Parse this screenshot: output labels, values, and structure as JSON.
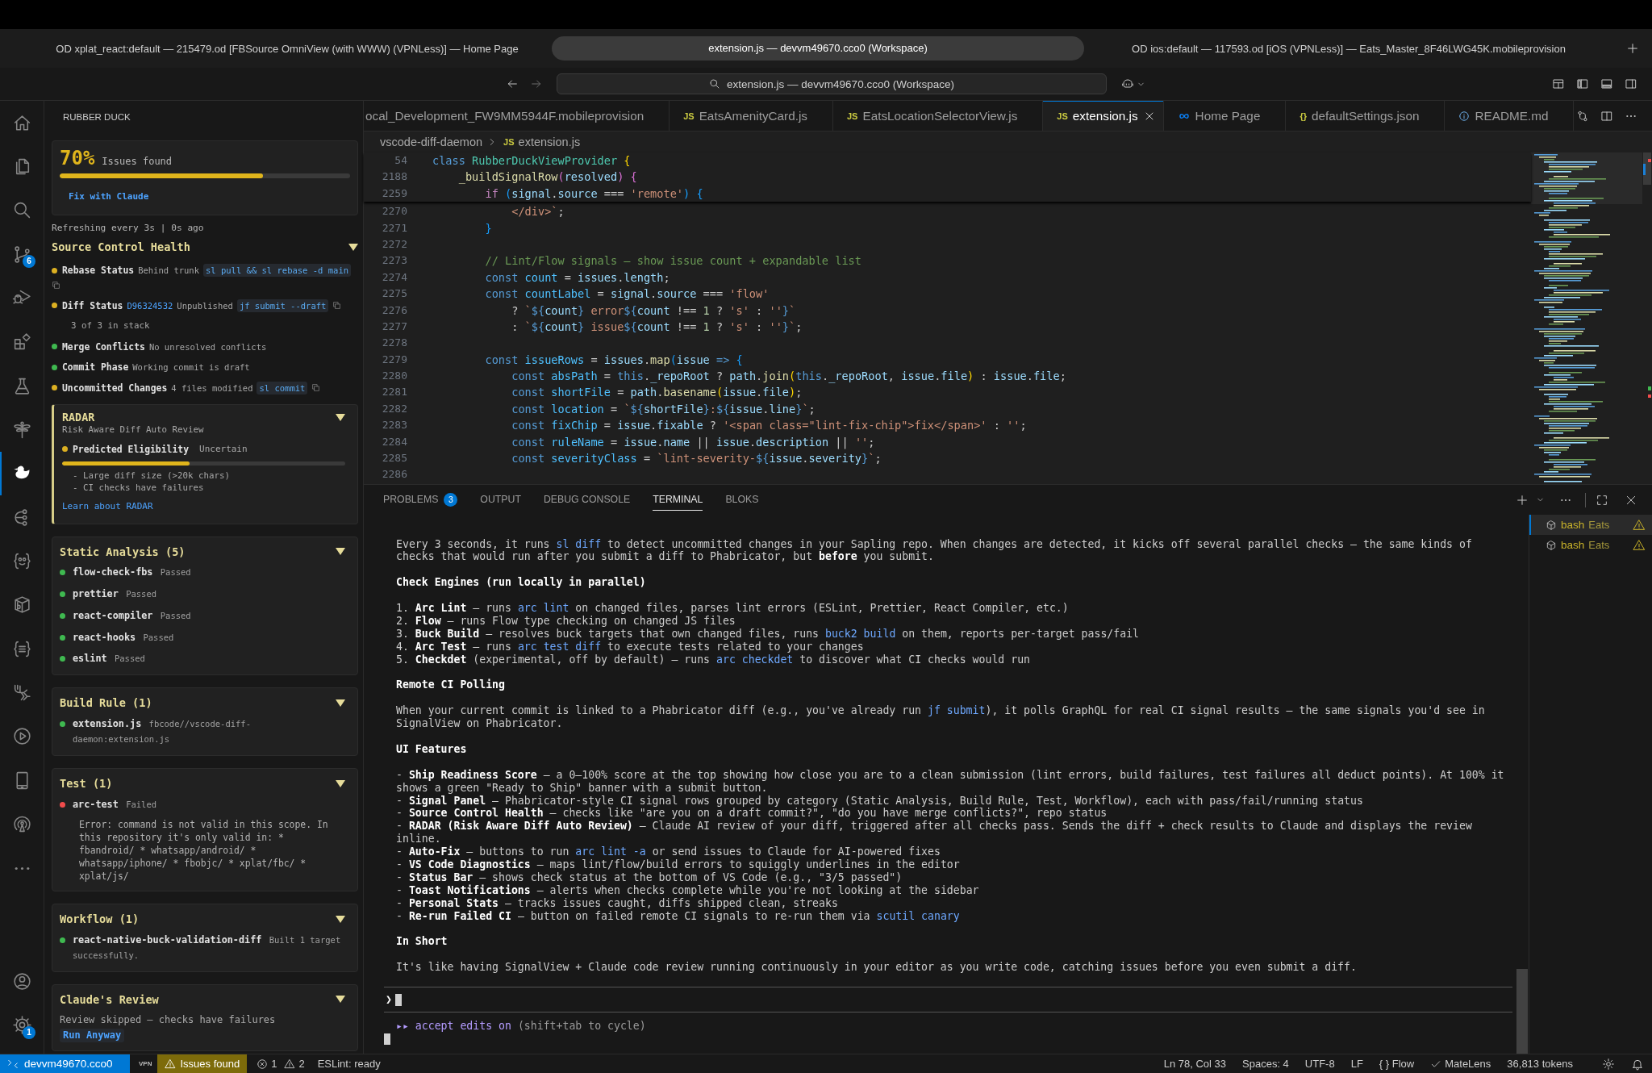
{
  "browser_tabs": [
    {
      "title": "OD xplat_react:default — 215479.od [FBSource OmniView (with WWW) (VPNLess)] — Home Page",
      "selected": false
    },
    {
      "title": "extension.js — devvm49670.cco0 (Workspace)",
      "selected": true
    },
    {
      "title": "OD ios:default — 117593.od [iOS (VPNLess)] — Eats_Master_8F46LWG45K.mobileprovision",
      "selected": false
    }
  ],
  "command_center": {
    "text": "extension.js — devvm49670.cco0 (Workspace)"
  },
  "activity_bar": {
    "items": [
      {
        "selected": false
      },
      {
        "selected": false
      },
      {
        "selected": false
      },
      {
        "selected": false,
        "badge": "6"
      },
      {
        "selected": false
      },
      {
        "selected": false
      },
      {
        "selected": false
      },
      {
        "selected": false
      },
      {
        "selected": true
      },
      {
        "selected": false
      },
      {
        "selected": false
      },
      {
        "selected": false
      },
      {
        "selected": false
      },
      {
        "selected": false
      },
      {
        "selected": false
      },
      {
        "selected": false
      },
      {
        "selected": false
      },
      {
        "selected": false
      }
    ],
    "settings_badge": "1"
  },
  "sidebar": {
    "title": "RUBBER DUCK",
    "score": {
      "value": "70%",
      "label": "Issues found",
      "level": 0.7,
      "action": "Fix with Claude"
    },
    "refresh": "Refreshing every 3s | 0s ago",
    "source_control": {
      "title": "Source Control Health",
      "expanded": true,
      "rows": [
        {
          "color": "#dcb022",
          "label": "Rebase Status",
          "detail": "Behind trunk",
          "command": "sl pull && sl rebase -d main"
        },
        {
          "color": "#dcb022",
          "label": "Diff Status",
          "link": "D96324532",
          "detail": "Unpublished",
          "command": "jf submit --draft",
          "note": "3 of 3 in stack"
        },
        {
          "color": "#3fb950",
          "label": "Merge Conflicts",
          "detail": "No unresolved conflicts"
        },
        {
          "color": "#3fb950",
          "label": "Commit Phase",
          "detail": "Working commit is draft"
        },
        {
          "color": "#dcb022",
          "label": "Uncommitted Changes",
          "detail": "4 files modified",
          "command": "sl commit"
        }
      ]
    },
    "radar": {
      "title": "RADAR",
      "subtitle": "Risk Aware Diff Auto Review",
      "expanded": true,
      "color": "#dcb022",
      "label": "Predicted Eligibility",
      "value": "Uncertain",
      "level": 0.45,
      "reasons": [
        "- Large diff size (>20k chars)",
        "- CI checks have failures"
      ],
      "link": "Learn about RADAR"
    },
    "groups": [
      {
        "title": "Static Analysis (5)",
        "expanded": true,
        "signals": [
          {
            "color": "#3fb950",
            "name": "flow-check-fbs",
            "result": "Passed"
          },
          {
            "color": "#3fb950",
            "name": "prettier",
            "result": "Passed"
          },
          {
            "color": "#3fb950",
            "name": "react-compiler",
            "result": "Passed"
          },
          {
            "color": "#3fb950",
            "name": "react-hooks",
            "result": "Passed"
          },
          {
            "color": "#3fb950",
            "name": "eslint",
            "result": "Passed"
          }
        ]
      },
      {
        "title": "Build Rule (1)",
        "expanded": true,
        "signals": [
          {
            "color": "#3fb950",
            "name": "extension.js",
            "result": "fbcode//vscode-diff-daemon:extension.js"
          }
        ]
      },
      {
        "title": "Test (1)",
        "expanded": true,
        "signals": [
          {
            "color": "#f14c4c",
            "name": "arc-test",
            "result": "Failed",
            "error": "Error: command is not valid in this scope. In this repository it's only valid in: * fbandroid/ * whatsapp/android/ * whatsapp/iphone/ * fbobjc/ * xplat/fbc/ * xplat/js/"
          }
        ]
      },
      {
        "title": "Workflow (1)",
        "expanded": true,
        "signals": [
          {
            "color": "#3fb950",
            "name": "react-native-buck-validation-diff",
            "result": "Built 1 target successfully."
          }
        ]
      }
    ],
    "review": {
      "title": "Claude's Review",
      "expanded": true,
      "message": "Review skipped — checks have failures",
      "action": "Run Anyway"
    }
  },
  "editor_tabs": [
    {
      "label": "ocal_Development_FW9MM5944F.mobileprovision",
      "kind": "plain",
      "selected": false
    },
    {
      "label": "EatsAmenityCard.js",
      "kind": "badge",
      "badge": "JS",
      "selected": false
    },
    {
      "label": "EatsLocationSelectorView.js",
      "kind": "badge",
      "badge": "JS",
      "selected": false
    },
    {
      "label": "extension.js",
      "kind": "badge",
      "badge": "JS",
      "selected": true
    },
    {
      "label": "Home Page",
      "kind": "page",
      "selected": false
    },
    {
      "label": "defaultSettings.json",
      "kind": "badge",
      "badge": "{}",
      "selected": false
    },
    {
      "label": "README.md",
      "kind": "info",
      "selected": false
    }
  ],
  "breadcrumb": {
    "folder": "vscode-diff-daemon",
    "file_badge": "JS",
    "file": "extension.js"
  },
  "editor": {
    "sticky_lines": [
      {
        "number": "54",
        "tokens": [
          {
            "kind": "keyword",
            "text": "class "
          },
          {
            "kind": "type",
            "text": "RubberDuckViewProvider "
          },
          {
            "kind": "bracket1",
            "text": "{"
          }
        ]
      },
      {
        "number": "2188",
        "tokens": [
          {
            "kind": "function",
            "text": "    _buildSignalRow"
          },
          {
            "kind": "bracket2",
            "text": "("
          },
          {
            "kind": "variable",
            "text": "resolved"
          },
          {
            "kind": "bracket2",
            "text": ") {"
          }
        ]
      },
      {
        "number": "2259",
        "tokens": [
          {
            "kind": "control",
            "text": "        if "
          },
          {
            "kind": "bracket3",
            "text": "("
          },
          {
            "kind": "variable",
            "text": "signal"
          },
          {
            "kind": "plain",
            "text": "."
          },
          {
            "kind": "variable",
            "text": "source"
          },
          {
            "kind": "plain",
            "text": " === "
          },
          {
            "kind": "string",
            "text": "'remote'"
          },
          {
            "kind": "bracket3",
            "text": ") {"
          }
        ]
      }
    ],
    "lines": [
      {
        "number": "2270",
        "tokens": [
          {
            "kind": "string",
            "text": "            </div>`"
          },
          {
            "kind": "plain",
            "text": ";"
          }
        ]
      },
      {
        "number": "2271",
        "tokens": [
          {
            "kind": "bracket3",
            "text": "        }"
          }
        ]
      },
      {
        "number": "2272"
      },
      {
        "number": "2273",
        "tokens": [
          {
            "kind": "comment",
            "text": "        // Lint/Flow signals — show issue count + expandable list"
          }
        ]
      },
      {
        "number": "2274",
        "tokens": [
          {
            "kind": "keyword",
            "text": "        const "
          },
          {
            "kind": "constant",
            "text": "count"
          },
          {
            "kind": "plain",
            "text": " = "
          },
          {
            "kind": "variable",
            "text": "issues"
          },
          {
            "kind": "plain",
            "text": "."
          },
          {
            "kind": "variable",
            "text": "length"
          },
          {
            "kind": "plain",
            "text": ";"
          }
        ]
      },
      {
        "number": "2275",
        "tokens": [
          {
            "kind": "keyword",
            "text": "        const "
          },
          {
            "kind": "constant",
            "text": "countLabel"
          },
          {
            "kind": "plain",
            "text": " = "
          },
          {
            "kind": "variable",
            "text": "signal"
          },
          {
            "kind": "plain",
            "text": "."
          },
          {
            "kind": "variable",
            "text": "source"
          },
          {
            "kind": "plain",
            "text": " === "
          },
          {
            "kind": "string",
            "text": "'flow'"
          }
        ]
      },
      {
        "number": "2276",
        "tokens": [
          {
            "kind": "plain",
            "text": "            ? "
          },
          {
            "kind": "string",
            "text": "`"
          },
          {
            "kind": "keyword",
            "text": "${"
          },
          {
            "kind": "variable",
            "text": "count"
          },
          {
            "kind": "keyword",
            "text": "}"
          },
          {
            "kind": "string",
            "text": " error"
          },
          {
            "kind": "keyword",
            "text": "${"
          },
          {
            "kind": "variable",
            "text": "count"
          },
          {
            "kind": "plain",
            "text": " !== "
          },
          {
            "kind": "number",
            "text": "1"
          },
          {
            "kind": "plain",
            "text": " ? "
          },
          {
            "kind": "string",
            "text": "'s'"
          },
          {
            "kind": "plain",
            "text": " : "
          },
          {
            "kind": "string",
            "text": "''"
          },
          {
            "kind": "keyword",
            "text": "}"
          },
          {
            "kind": "string",
            "text": "`"
          }
        ]
      },
      {
        "number": "2277",
        "tokens": [
          {
            "kind": "plain",
            "text": "            : "
          },
          {
            "kind": "string",
            "text": "`"
          },
          {
            "kind": "keyword",
            "text": "${"
          },
          {
            "kind": "variable",
            "text": "count"
          },
          {
            "kind": "keyword",
            "text": "}"
          },
          {
            "kind": "string",
            "text": " issue"
          },
          {
            "kind": "keyword",
            "text": "${"
          },
          {
            "kind": "variable",
            "text": "count"
          },
          {
            "kind": "plain",
            "text": " !== "
          },
          {
            "kind": "number",
            "text": "1"
          },
          {
            "kind": "plain",
            "text": " ? "
          },
          {
            "kind": "string",
            "text": "'s'"
          },
          {
            "kind": "plain",
            "text": " : "
          },
          {
            "kind": "string",
            "text": "''"
          },
          {
            "kind": "keyword",
            "text": "}"
          },
          {
            "kind": "string",
            "text": "`"
          },
          {
            "kind": "plain",
            "text": ";"
          }
        ]
      },
      {
        "number": "2278"
      },
      {
        "number": "2279",
        "tokens": [
          {
            "kind": "keyword",
            "text": "        const "
          },
          {
            "kind": "constant",
            "text": "issueRows"
          },
          {
            "kind": "plain",
            "text": " = "
          },
          {
            "kind": "variable",
            "text": "issues"
          },
          {
            "kind": "plain",
            "text": "."
          },
          {
            "kind": "function",
            "text": "map"
          },
          {
            "kind": "bracket3",
            "text": "("
          },
          {
            "kind": "variable",
            "text": "issue "
          },
          {
            "kind": "keyword",
            "text": "=> "
          },
          {
            "kind": "bracket3",
            "text": "{"
          }
        ]
      },
      {
        "number": "2280",
        "tokens": [
          {
            "kind": "keyword",
            "text": "            const "
          },
          {
            "kind": "constant",
            "text": "absPath"
          },
          {
            "kind": "plain",
            "text": " = "
          },
          {
            "kind": "keyword",
            "text": "this"
          },
          {
            "kind": "plain",
            "text": "."
          },
          {
            "kind": "variable",
            "text": "_repoRoot"
          },
          {
            "kind": "plain",
            "text": " ? "
          },
          {
            "kind": "variable",
            "text": "path"
          },
          {
            "kind": "plain",
            "text": "."
          },
          {
            "kind": "function",
            "text": "join"
          },
          {
            "kind": "bracket1",
            "text": "("
          },
          {
            "kind": "keyword",
            "text": "this"
          },
          {
            "kind": "plain",
            "text": "."
          },
          {
            "kind": "variable",
            "text": "_repoRoot"
          },
          {
            "kind": "plain",
            "text": ", "
          },
          {
            "kind": "variable",
            "text": "issue"
          },
          {
            "kind": "plain",
            "text": "."
          },
          {
            "kind": "variable",
            "text": "file"
          },
          {
            "kind": "bracket1",
            "text": ")"
          },
          {
            "kind": "plain",
            "text": " : "
          },
          {
            "kind": "variable",
            "text": "issue"
          },
          {
            "kind": "plain",
            "text": "."
          },
          {
            "kind": "variable",
            "text": "file"
          },
          {
            "kind": "plain",
            "text": ";"
          }
        ]
      },
      {
        "number": "2281",
        "tokens": [
          {
            "kind": "keyword",
            "text": "            const "
          },
          {
            "kind": "constant",
            "text": "shortFile"
          },
          {
            "kind": "plain",
            "text": " = "
          },
          {
            "kind": "variable",
            "text": "path"
          },
          {
            "kind": "plain",
            "text": "."
          },
          {
            "kind": "function",
            "text": "basename"
          },
          {
            "kind": "bracket1",
            "text": "("
          },
          {
            "kind": "variable",
            "text": "issue"
          },
          {
            "kind": "plain",
            "text": "."
          },
          {
            "kind": "variable",
            "text": "file"
          },
          {
            "kind": "bracket1",
            "text": ")"
          },
          {
            "kind": "plain",
            "text": ";"
          }
        ]
      },
      {
        "number": "2282",
        "tokens": [
          {
            "kind": "keyword",
            "text": "            const "
          },
          {
            "kind": "constant",
            "text": "location"
          },
          {
            "kind": "plain",
            "text": " = "
          },
          {
            "kind": "string",
            "text": "`"
          },
          {
            "kind": "keyword",
            "text": "${"
          },
          {
            "kind": "variable",
            "text": "shortFile"
          },
          {
            "kind": "keyword",
            "text": "}"
          },
          {
            "kind": "string",
            "text": ":"
          },
          {
            "kind": "keyword",
            "text": "${"
          },
          {
            "kind": "variable",
            "text": "issue"
          },
          {
            "kind": "plain",
            "text": "."
          },
          {
            "kind": "variable",
            "text": "line"
          },
          {
            "kind": "keyword",
            "text": "}"
          },
          {
            "kind": "string",
            "text": "`"
          },
          {
            "kind": "plain",
            "text": ";"
          }
        ]
      },
      {
        "number": "2283",
        "tokens": [
          {
            "kind": "keyword",
            "text": "            const "
          },
          {
            "kind": "constant",
            "text": "fixChip"
          },
          {
            "kind": "plain",
            "text": " = "
          },
          {
            "kind": "variable",
            "text": "issue"
          },
          {
            "kind": "plain",
            "text": "."
          },
          {
            "kind": "variable",
            "text": "fixable"
          },
          {
            "kind": "plain",
            "text": " ? "
          },
          {
            "kind": "string",
            "text": "'<span class=\"lint-fix-chip\">fix</span>'"
          },
          {
            "kind": "plain",
            "text": " : "
          },
          {
            "kind": "string",
            "text": "''"
          },
          {
            "kind": "plain",
            "text": ";"
          }
        ]
      },
      {
        "number": "2284",
        "tokens": [
          {
            "kind": "keyword",
            "text": "            const "
          },
          {
            "kind": "constant",
            "text": "ruleName"
          },
          {
            "kind": "plain",
            "text": " = "
          },
          {
            "kind": "variable",
            "text": "issue"
          },
          {
            "kind": "plain",
            "text": "."
          },
          {
            "kind": "variable",
            "text": "name"
          },
          {
            "kind": "plain",
            "text": " || "
          },
          {
            "kind": "variable",
            "text": "issue"
          },
          {
            "kind": "plain",
            "text": "."
          },
          {
            "kind": "variable",
            "text": "description"
          },
          {
            "kind": "plain",
            "text": " || "
          },
          {
            "kind": "string",
            "text": "''"
          },
          {
            "kind": "plain",
            "text": ";"
          }
        ]
      },
      {
        "number": "2285",
        "tokens": [
          {
            "kind": "keyword",
            "text": "            const "
          },
          {
            "kind": "constant",
            "text": "severityClass"
          },
          {
            "kind": "plain",
            "text": " = "
          },
          {
            "kind": "string",
            "text": "`lint-severity-"
          },
          {
            "kind": "keyword",
            "text": "${"
          },
          {
            "kind": "variable",
            "text": "issue"
          },
          {
            "kind": "plain",
            "text": "."
          },
          {
            "kind": "variable",
            "text": "severity"
          },
          {
            "kind": "keyword",
            "text": "}"
          },
          {
            "kind": "string",
            "text": "`"
          },
          {
            "kind": "plain",
            "text": ";"
          }
        ]
      },
      {
        "number": "2286"
      }
    ]
  },
  "panel": {
    "tabs": [
      {
        "label": "PROBLEMS",
        "badge": "3",
        "selected": false
      },
      {
        "label": "OUTPUT",
        "selected": false
      },
      {
        "label": "DEBUG CONSOLE",
        "selected": false
      },
      {
        "label": "TERMINAL",
        "selected": true
      },
      {
        "label": "BLOKS",
        "selected": false
      }
    ]
  },
  "terminal": {
    "blocks": [
      {
        "kind": "paragraph",
        "segments": [
          {
            "kind": "plain",
            "text": "Every 3 seconds, it runs "
          },
          {
            "kind": "code",
            "text": "sl diff"
          },
          {
            "kind": "plain",
            "text": " to detect uncommitted changes in your Sapling repo. When changes are detected, it kicks off several parallel checks — the same kinds of checks that would run after you submit a diff to Phabricator, but "
          },
          {
            "kind": "bold",
            "text": "before"
          },
          {
            "kind": "plain",
            "text": " you submit."
          }
        ]
      },
      {
        "kind": "heading",
        "text": "Check Engines (run locally in parallel)"
      },
      {
        "kind": "list",
        "items": [
          {
            "segments": [
              {
                "kind": "plain",
                "text": "1. "
              },
              {
                "kind": "bold",
                "text": "Arc Lint"
              },
              {
                "kind": "plain",
                "text": " — runs "
              },
              {
                "kind": "code",
                "text": "arc lint"
              },
              {
                "kind": "plain",
                "text": " on changed files, parses lint errors (ESLint, Prettier, React Compiler, etc.)"
              }
            ]
          },
          {
            "segments": [
              {
                "kind": "plain",
                "text": "2. "
              },
              {
                "kind": "bold",
                "text": "Flow"
              },
              {
                "kind": "plain",
                "text": " — runs Flow type checking on changed JS files"
              }
            ]
          },
          {
            "segments": [
              {
                "kind": "plain",
                "text": "3. "
              },
              {
                "kind": "bold",
                "text": "Buck Build"
              },
              {
                "kind": "plain",
                "text": " — resolves buck targets that own changed files, runs "
              },
              {
                "kind": "code",
                "text": "buck2 build"
              },
              {
                "kind": "plain",
                "text": " on them, reports per-target pass/fail"
              }
            ]
          },
          {
            "segments": [
              {
                "kind": "plain",
                "text": "4. "
              },
              {
                "kind": "bold",
                "text": "Arc Test"
              },
              {
                "kind": "plain",
                "text": " — runs "
              },
              {
                "kind": "code",
                "text": "arc test diff"
              },
              {
                "kind": "plain",
                "text": " to execute tests related to your changes"
              }
            ]
          },
          {
            "segments": [
              {
                "kind": "plain",
                "text": "5. "
              },
              {
                "kind": "bold",
                "text": "Checkdet"
              },
              {
                "kind": "plain",
                "text": " (experimental, off by default) — runs "
              },
              {
                "kind": "code",
                "text": "arc checkdet"
              },
              {
                "kind": "plain",
                "text": " to discover what CI checks would run"
              }
            ]
          }
        ]
      },
      {
        "kind": "heading",
        "text": "Remote CI Polling"
      },
      {
        "kind": "paragraph",
        "segments": [
          {
            "kind": "plain",
            "text": "When your current commit is linked to a Phabricator diff (e.g., you've already run "
          },
          {
            "kind": "code",
            "text": "jf submit"
          },
          {
            "kind": "plain",
            "text": "), it polls GraphQL for real CI signal results — the same signals you'd see in SignalView on Phabricator."
          }
        ]
      },
      {
        "kind": "heading",
        "text": "UI Features"
      },
      {
        "kind": "list",
        "items": [
          {
            "segments": [
              {
                "kind": "plain",
                "text": "- "
              },
              {
                "kind": "bold",
                "text": "Ship Readiness Score"
              },
              {
                "kind": "plain",
                "text": " — a 0–100% score at the top showing how close you are to a clean submission (lint errors, build failures, test failures all deduct points). At 100% it shows a green \"Ready to Ship\" banner with a submit button."
              }
            ]
          },
          {
            "segments": [
              {
                "kind": "plain",
                "text": "- "
              },
              {
                "kind": "bold",
                "text": "Signal Panel"
              },
              {
                "kind": "plain",
                "text": " — Phabricator-style CI signal rows grouped by category (Static Analysis, Build Rule, Test, Workflow), each with pass/fail/running status"
              }
            ]
          },
          {
            "segments": [
              {
                "kind": "plain",
                "text": "- "
              },
              {
                "kind": "bold",
                "text": "Source Control Health"
              },
              {
                "kind": "plain",
                "text": " — checks like \"are you on a draft commit?\", \"do you have merge conflicts?\", repo status"
              }
            ]
          },
          {
            "segments": [
              {
                "kind": "plain",
                "text": "- "
              },
              {
                "kind": "bold",
                "text": "RADAR (Risk Aware Diff Auto Review)"
              },
              {
                "kind": "plain",
                "text": " — Claude AI review of your diff, triggered after all checks pass. Sends the diff + check results to Claude and displays the review inline."
              }
            ]
          },
          {
            "segments": [
              {
                "kind": "plain",
                "text": "- "
              },
              {
                "kind": "bold",
                "text": "Auto-Fix"
              },
              {
                "kind": "plain",
                "text": " — buttons to run "
              },
              {
                "kind": "code",
                "text": "arc lint -a"
              },
              {
                "kind": "plain",
                "text": " or send issues to Claude for AI-powered fixes"
              }
            ]
          },
          {
            "segments": [
              {
                "kind": "plain",
                "text": "- "
              },
              {
                "kind": "bold",
                "text": "VS Code Diagnostics"
              },
              {
                "kind": "plain",
                "text": " — maps lint/flow/build errors to squiggly underlines in the editor"
              }
            ]
          },
          {
            "segments": [
              {
                "kind": "plain",
                "text": "- "
              },
              {
                "kind": "bold",
                "text": "Status Bar"
              },
              {
                "kind": "plain",
                "text": " — shows check status at the bottom of VS Code (e.g., \"3/5 passed\")"
              }
            ]
          },
          {
            "segments": [
              {
                "kind": "plain",
                "text": "- "
              },
              {
                "kind": "bold",
                "text": "Toast Notifications"
              },
              {
                "kind": "plain",
                "text": " — alerts when checks complete while you're not looking at the sidebar"
              }
            ]
          },
          {
            "segments": [
              {
                "kind": "plain",
                "text": "- "
              },
              {
                "kind": "bold",
                "text": "Personal Stats"
              },
              {
                "kind": "plain",
                "text": " — tracks issues caught, diffs shipped clean, streaks"
              }
            ]
          },
          {
            "segments": [
              {
                "kind": "plain",
                "text": "- "
              },
              {
                "kind": "bold",
                "text": "Re-run Failed CI"
              },
              {
                "kind": "plain",
                "text": " — button on failed remote CI signals to re-run them via "
              },
              {
                "kind": "code",
                "text": "scutil canary"
              }
            ]
          }
        ]
      },
      {
        "kind": "heading",
        "text": "In Short"
      },
      {
        "kind": "paragraph",
        "segments": [
          {
            "kind": "plain",
            "text": "It's like having SignalView + Claude code review running continuously in your editor as you write code, catching issues before you even submit a diff."
          }
        ]
      }
    ],
    "prompt": {
      "symbol": "❯",
      "mode": "▸▸ accept edits on",
      "hint": "(shift+tab to cycle)"
    }
  },
  "terminal_sessions": [
    {
      "name": "bash",
      "folder": "Eats",
      "selected": true,
      "warning": true
    },
    {
      "name": "bash",
      "folder": "Eats",
      "selected": false,
      "warning": true
    }
  ],
  "status_bar": {
    "remote": "devvm49670.cco0",
    "vpn": "VPN",
    "issues": "Issues found",
    "errors": "1",
    "warnings": "2",
    "linter": "ESLint: ready",
    "position": "Ln 78, Col 33",
    "indentation": "Spaces: 4",
    "encoding": "UTF-8",
    "line_ending": "LF",
    "language": "{ } Flow",
    "reviewer": "MateLens",
    "tokens": "36,813 tokens"
  }
}
